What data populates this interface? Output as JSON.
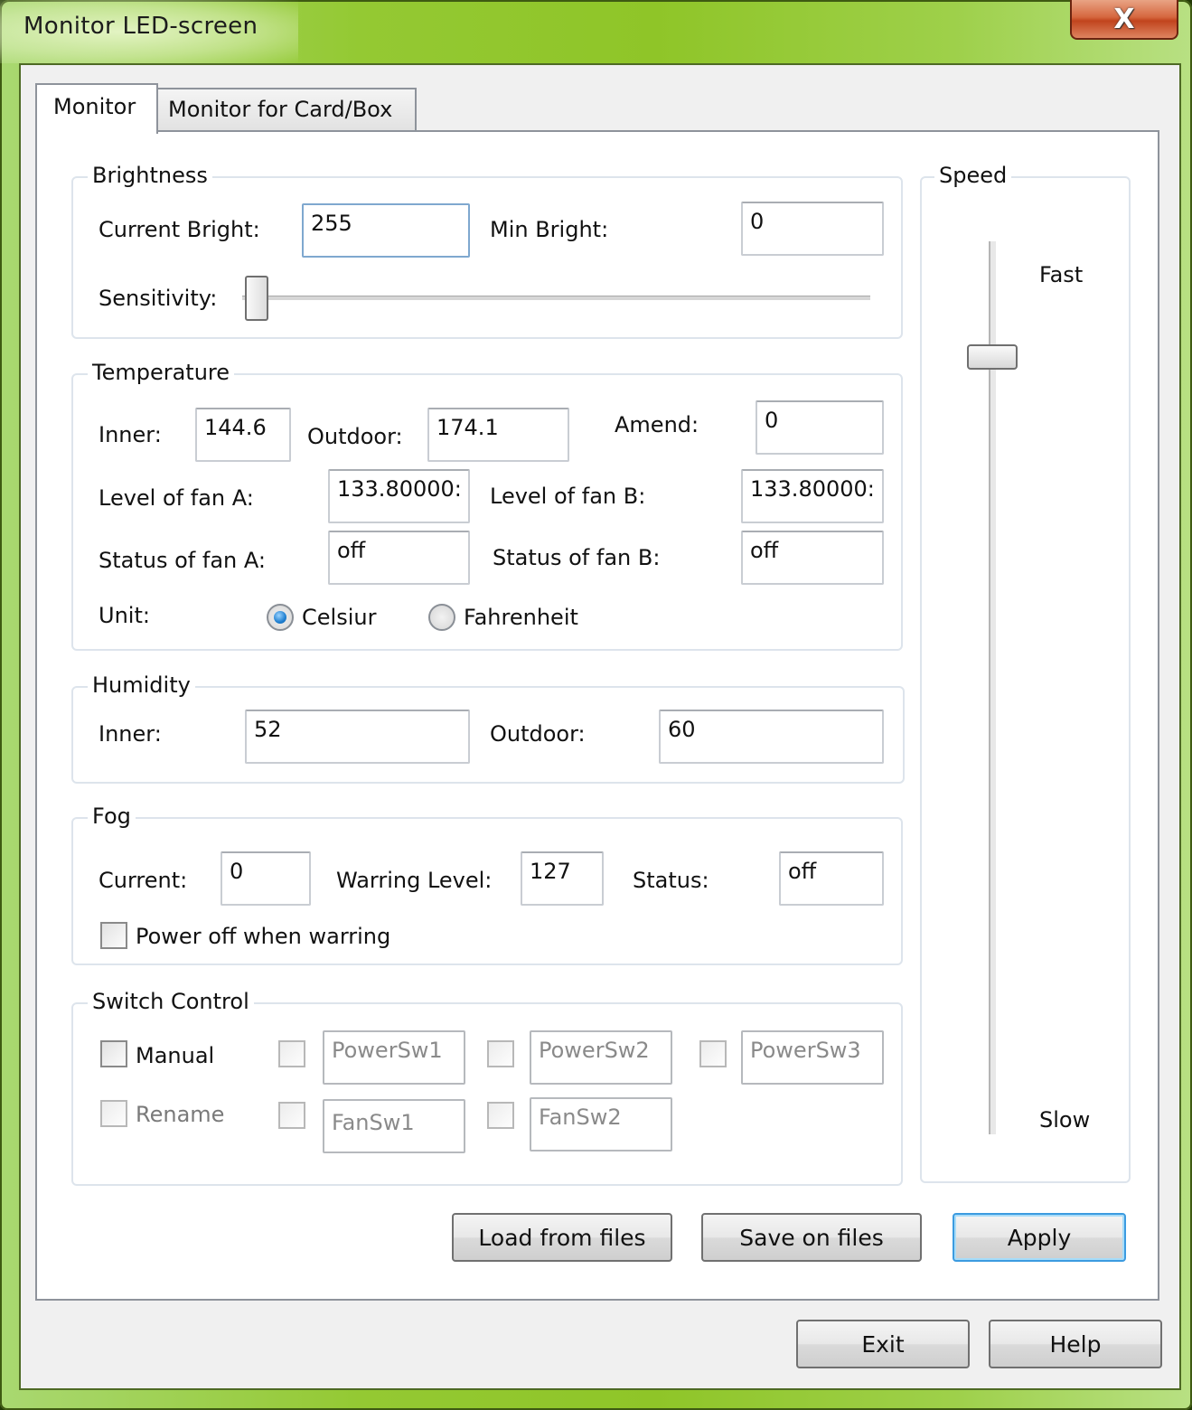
{
  "window": {
    "title": "Monitor LED-screen",
    "close_icon": "x-close-icon"
  },
  "tabs": [
    {
      "label": "Monitor",
      "active": true
    },
    {
      "label": "Monitor for Card/Box",
      "active": false
    }
  ],
  "brightness": {
    "title": "Brightness",
    "current_label": "Current Bright:",
    "current_value": "255",
    "min_label": "Min Bright:",
    "min_value": "0",
    "sensitivity_label": "Sensitivity:",
    "sensitivity_fraction": 0.0
  },
  "temperature": {
    "title": "Temperature",
    "inner_label": "Inner:",
    "inner_value": "144.6",
    "outdoor_label": "Outdoor:",
    "outdoor_value": "174.1",
    "amend_label": "Amend:",
    "amend_value": "0",
    "fan_a_level_label": "Level of fan A:",
    "fan_a_level_value": "133.80000:",
    "fan_b_level_label": "Level of fan B:",
    "fan_b_level_value": "133.80000:",
    "fan_a_status_label": "Status of fan A:",
    "fan_a_status_value": "off",
    "fan_b_status_label": "Status of fan B:",
    "fan_b_status_value": "off",
    "unit_label": "Unit:",
    "unit_options": [
      {
        "label": "Celsiur",
        "selected": true
      },
      {
        "label": "Fahrenheit",
        "selected": false
      }
    ]
  },
  "humidity": {
    "title": "Humidity",
    "inner_label": "Inner:",
    "inner_value": "52",
    "outdoor_label": "Outdoor:",
    "outdoor_value": "60"
  },
  "fog": {
    "title": "Fog",
    "current_label": "Current:",
    "current_value": "0",
    "warning_label": "Warring Level:",
    "warning_value": "127",
    "status_label": "Status:",
    "status_value": "off",
    "power_off_label": "Power off when warring",
    "power_off_checked": false
  },
  "switch_control": {
    "title": "Switch Control",
    "manual_label": "Manual",
    "rename_label": "Rename",
    "switches": [
      "PowerSw1",
      "PowerSw2",
      "PowerSw3",
      "FanSw1",
      "FanSw2"
    ]
  },
  "speed": {
    "title": "Speed",
    "fast_label": "Fast",
    "slow_label": "Slow",
    "level_fraction_from_top": 0.13
  },
  "buttons": {
    "load": "Load from files",
    "save": "Save on files",
    "apply": "Apply",
    "exit": "Exit",
    "help": "Help"
  },
  "colors": {
    "title_bar": "#8fc528",
    "close_button": "#c1441d",
    "default_button_border": "#3c9be0"
  }
}
